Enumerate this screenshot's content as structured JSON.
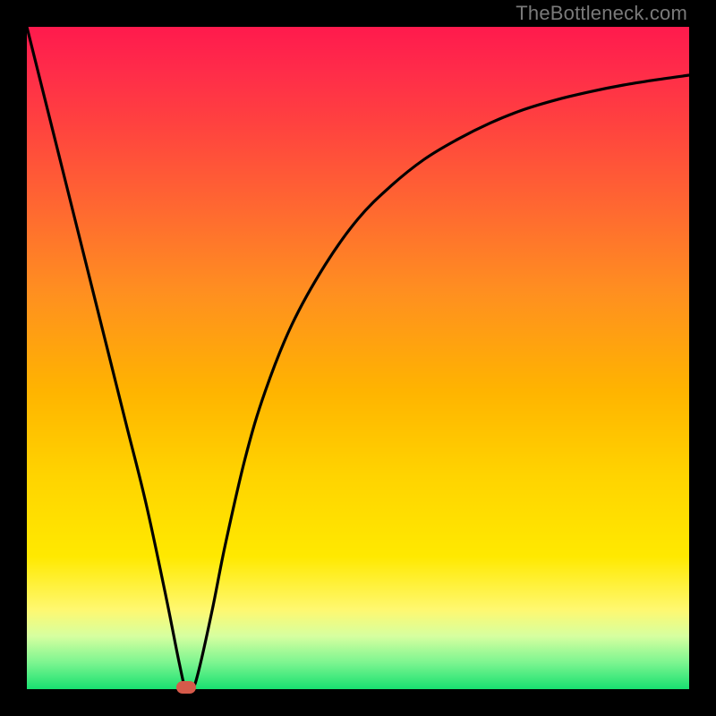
{
  "watermark": "TheBottleneck.com",
  "chart_data": {
    "type": "line",
    "title": "",
    "xlabel": "",
    "ylabel": "",
    "xlim": [
      0,
      100
    ],
    "ylim": [
      0,
      100
    ],
    "gradient_stops": [
      {
        "pct": 0,
        "color": "#ff1a4d"
      },
      {
        "pct": 14,
        "color": "#ff4040"
      },
      {
        "pct": 40,
        "color": "#ff8f20"
      },
      {
        "pct": 68,
        "color": "#ffd400"
      },
      {
        "pct": 88,
        "color": "#fff870"
      },
      {
        "pct": 96,
        "color": "#7cf590"
      },
      {
        "pct": 100,
        "color": "#18e070"
      }
    ],
    "series": [
      {
        "name": "bottleneck-curve",
        "x": [
          0,
          3,
          6,
          9,
          12,
          15,
          18,
          21,
          23,
          24,
          25,
          26,
          28,
          30,
          33,
          36,
          40,
          45,
          50,
          55,
          60,
          65,
          70,
          75,
          80,
          85,
          90,
          95,
          100
        ],
        "y": [
          100,
          88,
          76,
          64,
          52,
          40,
          28,
          14,
          4,
          0,
          0,
          3,
          12,
          22,
          35,
          45,
          55,
          64,
          71,
          76,
          80,
          83,
          85.5,
          87.5,
          89,
          90.2,
          91.2,
          92,
          92.7
        ]
      }
    ],
    "marker": {
      "x": 24,
      "y": 0,
      "color": "#d65a4a"
    }
  }
}
